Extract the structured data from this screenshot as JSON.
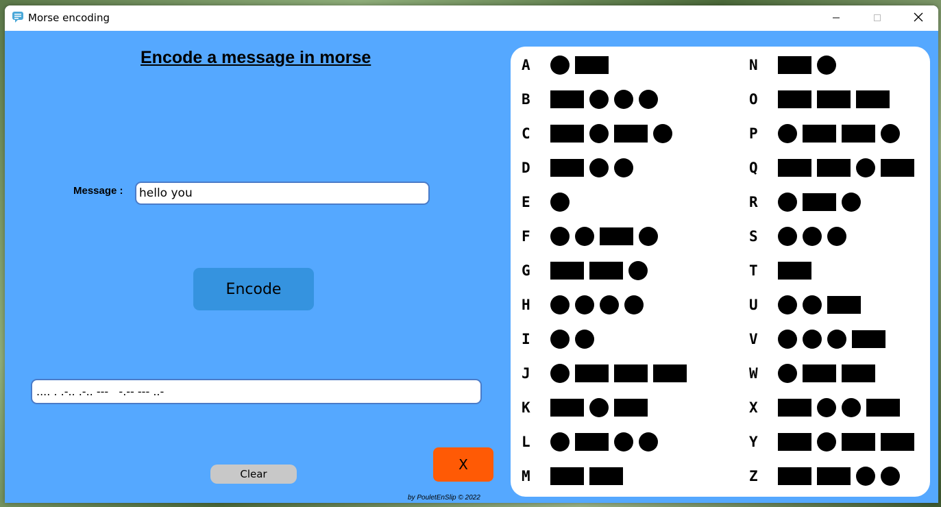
{
  "window": {
    "title": "Morse encoding"
  },
  "main": {
    "heading": "Encode a message in morse",
    "message_label": "Message :",
    "message_value": "hello you",
    "encode_label": "Encode",
    "output_value": ".... . .-.. .-.. ---   -.-- --- ..-",
    "clear_label": "Clear",
    "close_label": "X",
    "credit": "by PouletEnSlip © 2022"
  },
  "morse_chart": {
    "left_column": [
      {
        "letter": "A",
        "code": ".-"
      },
      {
        "letter": "B",
        "code": "-..."
      },
      {
        "letter": "C",
        "code": "-.-."
      },
      {
        "letter": "D",
        "code": "-.."
      },
      {
        "letter": "E",
        "code": "."
      },
      {
        "letter": "F",
        "code": "..-."
      },
      {
        "letter": "G",
        "code": "--."
      },
      {
        "letter": "H",
        "code": "...."
      },
      {
        "letter": "I",
        "code": ".."
      },
      {
        "letter": "J",
        "code": ".---"
      },
      {
        "letter": "K",
        "code": "-.-"
      },
      {
        "letter": "L",
        "code": ".-.."
      },
      {
        "letter": "M",
        "code": "--"
      }
    ],
    "right_column": [
      {
        "letter": "N",
        "code": "-."
      },
      {
        "letter": "O",
        "code": "---"
      },
      {
        "letter": "P",
        "code": ".--."
      },
      {
        "letter": "Q",
        "code": "--.-"
      },
      {
        "letter": "R",
        "code": ".-."
      },
      {
        "letter": "S",
        "code": "..."
      },
      {
        "letter": "T",
        "code": "-"
      },
      {
        "letter": "U",
        "code": "..-"
      },
      {
        "letter": "V",
        "code": "...-"
      },
      {
        "letter": "W",
        "code": ".--"
      },
      {
        "letter": "X",
        "code": "-..-"
      },
      {
        "letter": "Y",
        "code": "-.--"
      },
      {
        "letter": "Z",
        "code": "--.."
      }
    ]
  },
  "colors": {
    "background": "#55a8ff",
    "encode_button": "#3593df",
    "close_button": "#ff5a05",
    "clear_button": "#c8c8c8"
  },
  "icons": {
    "app": "chat-bubble-icon",
    "minimize": "minimize-icon",
    "maximize": "maximize-icon",
    "close": "close-icon"
  }
}
